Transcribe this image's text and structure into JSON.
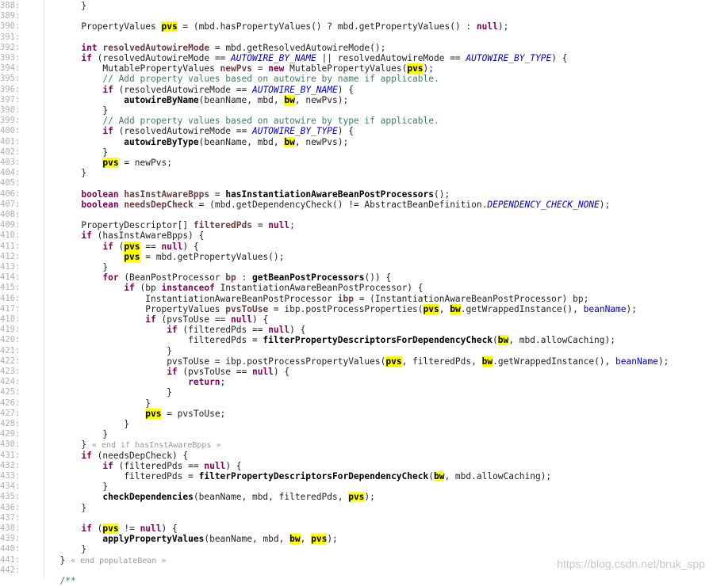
{
  "editor": {
    "lines": [
      {
        "n": "388:",
        "indent": "      ",
        "tokens": [
          [
            "pl",
            "}"
          ]
        ]
      },
      {
        "n": "389:",
        "indent": "",
        "tokens": []
      },
      {
        "n": "390:",
        "indent": "      ",
        "tokens": [
          [
            "pl",
            "PropertyValues "
          ],
          [
            "hl",
            "pvs"
          ],
          [
            "pl",
            " = (mbd.hasPropertyValues() ? mbd.getPropertyValues() : "
          ],
          [
            "kw",
            "null"
          ],
          [
            "pl",
            ");"
          ]
        ]
      },
      {
        "n": "391:",
        "indent": "",
        "tokens": []
      },
      {
        "n": "392:",
        "indent": "      ",
        "tokens": [
          [
            "kw",
            "int"
          ],
          [
            "pl",
            " "
          ],
          [
            "lc",
            "resolvedAutowireMode"
          ],
          [
            "pl",
            " = mbd.getResolvedAutowireMode();"
          ]
        ]
      },
      {
        "n": "393:",
        "indent": "      ",
        "tokens": [
          [
            "kw",
            "if"
          ],
          [
            "pl",
            " (resolvedAutowireMode == "
          ],
          [
            "const",
            "AUTOWIRE_BY_NAME"
          ],
          [
            "pl",
            " || resolvedAutowireMode == "
          ],
          [
            "const",
            "AUTOWIRE_BY_TYPE"
          ],
          [
            "pl",
            ") {"
          ]
        ]
      },
      {
        "n": "394:",
        "indent": "          ",
        "tokens": [
          [
            "pl",
            "MutablePropertyValues "
          ],
          [
            "lc",
            "newPvs"
          ],
          [
            "pl",
            " = "
          ],
          [
            "kw",
            "new"
          ],
          [
            "pl",
            " MutablePropertyValues("
          ],
          [
            "hl",
            "pvs"
          ],
          [
            "pl",
            ");"
          ]
        ]
      },
      {
        "n": "395:",
        "indent": "          ",
        "tokens": [
          [
            "cm",
            "// Add property values based on autowire by name if applicable."
          ]
        ]
      },
      {
        "n": "396:",
        "indent": "          ",
        "tokens": [
          [
            "kw",
            "if"
          ],
          [
            "pl",
            " (resolvedAutowireMode == "
          ],
          [
            "const",
            "AUTOWIRE_BY_NAME"
          ],
          [
            "pl",
            ") {"
          ]
        ]
      },
      {
        "n": "397:",
        "indent": "              ",
        "tokens": [
          [
            "fn",
            "autowireByName"
          ],
          [
            "pl",
            "(beanName, mbd, "
          ],
          [
            "hl",
            "bw"
          ],
          [
            "pl",
            ", newPvs);"
          ]
        ]
      },
      {
        "n": "398:",
        "indent": "          ",
        "tokens": [
          [
            "pl",
            "}"
          ]
        ]
      },
      {
        "n": "399:",
        "indent": "          ",
        "tokens": [
          [
            "cm",
            "// Add property values based on autowire by type if applicable."
          ]
        ]
      },
      {
        "n": "400:",
        "indent": "          ",
        "tokens": [
          [
            "kw",
            "if"
          ],
          [
            "pl",
            " (resolvedAutowireMode == "
          ],
          [
            "const",
            "AUTOWIRE_BY_TYPE"
          ],
          [
            "pl",
            ") {"
          ]
        ]
      },
      {
        "n": "401:",
        "indent": "              ",
        "tokens": [
          [
            "fn",
            "autowireByType"
          ],
          [
            "pl",
            "(beanName, mbd, "
          ],
          [
            "hl",
            "bw"
          ],
          [
            "pl",
            ", newPvs);"
          ]
        ]
      },
      {
        "n": "402:",
        "indent": "          ",
        "tokens": [
          [
            "pl",
            "}"
          ]
        ]
      },
      {
        "n": "403:",
        "indent": "          ",
        "tokens": [
          [
            "hl",
            "pvs"
          ],
          [
            "pl",
            " = newPvs;"
          ]
        ]
      },
      {
        "n": "404:",
        "indent": "      ",
        "tokens": [
          [
            "pl",
            "}"
          ]
        ]
      },
      {
        "n": "405:",
        "indent": "",
        "tokens": []
      },
      {
        "n": "406:",
        "indent": "      ",
        "tokens": [
          [
            "kw",
            "boolean"
          ],
          [
            "pl",
            " "
          ],
          [
            "lc",
            "hasInstAwareBpps"
          ],
          [
            "pl",
            " = "
          ],
          [
            "fn",
            "hasInstantiationAwareBeanPostProcessors"
          ],
          [
            "pl",
            "();"
          ]
        ]
      },
      {
        "n": "407:",
        "indent": "      ",
        "tokens": [
          [
            "kw",
            "boolean"
          ],
          [
            "pl",
            " "
          ],
          [
            "lc",
            "needsDepCheck"
          ],
          [
            "pl",
            " = (mbd.getDependencyCheck() != AbstractBeanDefinition."
          ],
          [
            "const",
            "DEPENDENCY_CHECK_NONE"
          ],
          [
            "pl",
            ");"
          ]
        ]
      },
      {
        "n": "408:",
        "indent": "",
        "tokens": []
      },
      {
        "n": "409:",
        "indent": "      ",
        "tokens": [
          [
            "pl",
            "PropertyDescriptor[] "
          ],
          [
            "lc",
            "filteredPds"
          ],
          [
            "pl",
            " = "
          ],
          [
            "kw",
            "null"
          ],
          [
            "pl",
            ";"
          ]
        ]
      },
      {
        "n": "410:",
        "indent": "      ",
        "tokens": [
          [
            "kw",
            "if"
          ],
          [
            "pl",
            " (hasInstAwareBpps) {"
          ]
        ]
      },
      {
        "n": "411:",
        "indent": "          ",
        "tokens": [
          [
            "kw",
            "if"
          ],
          [
            "pl",
            " ("
          ],
          [
            "hl",
            "pvs"
          ],
          [
            "pl",
            " == "
          ],
          [
            "kw",
            "null"
          ],
          [
            "pl",
            ") {"
          ]
        ]
      },
      {
        "n": "412:",
        "indent": "              ",
        "tokens": [
          [
            "hl",
            "pvs"
          ],
          [
            "pl",
            " = mbd.getPropertyValues();"
          ]
        ]
      },
      {
        "n": "413:",
        "indent": "          ",
        "tokens": [
          [
            "pl",
            "}"
          ]
        ]
      },
      {
        "n": "414:",
        "indent": "          ",
        "tokens": [
          [
            "kw",
            "for"
          ],
          [
            "pl",
            " (BeanPostProcessor "
          ],
          [
            "lc",
            "bp"
          ],
          [
            "pl",
            " : "
          ],
          [
            "fn",
            "getBeanPostProcessors"
          ],
          [
            "pl",
            "()) {"
          ]
        ]
      },
      {
        "n": "415:",
        "indent": "              ",
        "tokens": [
          [
            "kw",
            "if"
          ],
          [
            "pl",
            " (bp "
          ],
          [
            "kw",
            "instanceof"
          ],
          [
            "pl",
            " InstantiationAwareBeanPostProcessor) {"
          ]
        ]
      },
      {
        "n": "416:",
        "indent": "                  ",
        "tokens": [
          [
            "pl",
            "InstantiationAwareBeanPostProcessor "
          ],
          [
            "lc",
            "ibp"
          ],
          [
            "pl",
            " = (InstantiationAwareBeanPostProcessor) bp;"
          ]
        ]
      },
      {
        "n": "417:",
        "indent": "                  ",
        "tokens": [
          [
            "pl",
            "PropertyValues "
          ],
          [
            "lc",
            "pvsToUse"
          ],
          [
            "pl",
            " = ibp.postProcessProperties("
          ],
          [
            "hl",
            "pvs"
          ],
          [
            "pl",
            ", "
          ],
          [
            "hl",
            "bw"
          ],
          [
            "pl",
            ".getWrappedInstance(), "
          ],
          [
            "fd",
            "beanName"
          ],
          [
            "pl",
            ");"
          ]
        ]
      },
      {
        "n": "418:",
        "indent": "                  ",
        "tokens": [
          [
            "kw",
            "if"
          ],
          [
            "pl",
            " (pvsToUse == "
          ],
          [
            "kw",
            "null"
          ],
          [
            "pl",
            ") {"
          ]
        ]
      },
      {
        "n": "419:",
        "indent": "                      ",
        "tokens": [
          [
            "kw",
            "if"
          ],
          [
            "pl",
            " (filteredPds == "
          ],
          [
            "kw",
            "null"
          ],
          [
            "pl",
            ") {"
          ]
        ]
      },
      {
        "n": "420:",
        "indent": "                          ",
        "tokens": [
          [
            "pl",
            "filteredPds = "
          ],
          [
            "fn",
            "filterPropertyDescriptorsForDependencyCheck"
          ],
          [
            "pl",
            "("
          ],
          [
            "hl",
            "bw"
          ],
          [
            "pl",
            ", mbd.allowCaching);"
          ]
        ]
      },
      {
        "n": "421:",
        "indent": "                      ",
        "tokens": [
          [
            "pl",
            "}"
          ]
        ]
      },
      {
        "n": "422:",
        "indent": "                      ",
        "tokens": [
          [
            "pl",
            "pvsToUse = ibp.postProcessPropertyValues("
          ],
          [
            "hl",
            "pvs"
          ],
          [
            "pl",
            ", filteredPds, "
          ],
          [
            "hl",
            "bw"
          ],
          [
            "pl",
            ".getWrappedInstance(), "
          ],
          [
            "fd",
            "beanName"
          ],
          [
            "pl",
            ");"
          ]
        ]
      },
      {
        "n": "423:",
        "indent": "                      ",
        "tokens": [
          [
            "kw",
            "if"
          ],
          [
            "pl",
            " (pvsToUse == "
          ],
          [
            "kw",
            "null"
          ],
          [
            "pl",
            ") {"
          ]
        ]
      },
      {
        "n": "424:",
        "indent": "                          ",
        "tokens": [
          [
            "kw",
            "return"
          ],
          [
            "pl",
            ";"
          ]
        ]
      },
      {
        "n": "425:",
        "indent": "                      ",
        "tokens": [
          [
            "pl",
            "}"
          ]
        ]
      },
      {
        "n": "426:",
        "indent": "                  ",
        "tokens": [
          [
            "pl",
            "}"
          ]
        ]
      },
      {
        "n": "427:",
        "indent": "                  ",
        "tokens": [
          [
            "hl",
            "pvs"
          ],
          [
            "pl",
            " = pvsToUse;"
          ]
        ]
      },
      {
        "n": "428:",
        "indent": "              ",
        "tokens": [
          [
            "pl",
            "}"
          ]
        ]
      },
      {
        "n": "429:",
        "indent": "          ",
        "tokens": [
          [
            "pl",
            "}"
          ]
        ]
      },
      {
        "n": "430:",
        "indent": "      ",
        "tokens": [
          [
            "pl",
            "} "
          ],
          [
            "gray",
            "« end if hasInstAwareBpps »"
          ]
        ]
      },
      {
        "n": "431:",
        "indent": "      ",
        "tokens": [
          [
            "kw",
            "if"
          ],
          [
            "pl",
            " (needsDepCheck) {"
          ]
        ]
      },
      {
        "n": "432:",
        "indent": "          ",
        "tokens": [
          [
            "kw",
            "if"
          ],
          [
            "pl",
            " (filteredPds == "
          ],
          [
            "kw",
            "null"
          ],
          [
            "pl",
            ") {"
          ]
        ]
      },
      {
        "n": "433:",
        "indent": "              ",
        "tokens": [
          [
            "pl",
            "filteredPds = "
          ],
          [
            "fn",
            "filterPropertyDescriptorsForDependencyCheck"
          ],
          [
            "pl",
            "("
          ],
          [
            "hl",
            "bw"
          ],
          [
            "pl",
            ", mbd.allowCaching);"
          ]
        ]
      },
      {
        "n": "434:",
        "indent": "          ",
        "tokens": [
          [
            "pl",
            "}"
          ]
        ]
      },
      {
        "n": "435:",
        "indent": "          ",
        "tokens": [
          [
            "fn",
            "checkDependencies"
          ],
          [
            "pl",
            "(beanName, mbd, filteredPds, "
          ],
          [
            "hl",
            "pvs"
          ],
          [
            "pl",
            ");"
          ]
        ]
      },
      {
        "n": "436:",
        "indent": "      ",
        "tokens": [
          [
            "pl",
            "}"
          ]
        ]
      },
      {
        "n": "437:",
        "indent": "",
        "tokens": []
      },
      {
        "n": "438:",
        "indent": "      ",
        "tokens": [
          [
            "kw",
            "if"
          ],
          [
            "pl",
            " ("
          ],
          [
            "hl",
            "pvs"
          ],
          [
            "pl",
            " != "
          ],
          [
            "kw",
            "null"
          ],
          [
            "pl",
            ") {"
          ]
        ]
      },
      {
        "n": "439:",
        "indent": "          ",
        "tokens": [
          [
            "fn",
            "applyPropertyValues"
          ],
          [
            "pl",
            "(beanName, mbd, "
          ],
          [
            "hl",
            "bw"
          ],
          [
            "pl",
            ", "
          ],
          [
            "hl",
            "pvs"
          ],
          [
            "pl",
            ");"
          ]
        ]
      },
      {
        "n": "440:",
        "indent": "      ",
        "tokens": [
          [
            "pl",
            "}"
          ]
        ]
      },
      {
        "n": "441:",
        "indent": "  ",
        "tokens": [
          [
            "pl",
            "} "
          ],
          [
            "gray",
            "« end populateBean »"
          ]
        ]
      },
      {
        "n": "442:",
        "indent": "",
        "tokens": []
      },
      {
        "n": "",
        "indent": "  ",
        "tokens": [
          [
            "cm",
            "/**"
          ]
        ]
      }
    ]
  },
  "watermark": "https://blog.csdn.net/bruk_spp"
}
